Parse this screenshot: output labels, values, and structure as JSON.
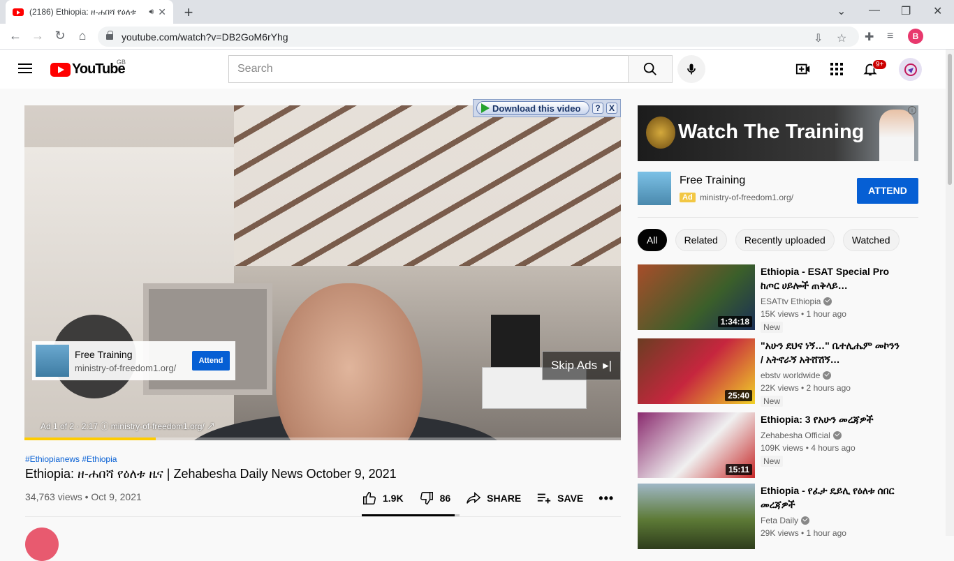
{
  "browser": {
    "tab_title": "(2186) Ethiopia: ዘ-ሐበሻ የዕለቱ",
    "url": "youtube.com/watch?v=DB2GoM6rYhg",
    "profile_initial": "B"
  },
  "header": {
    "logo_text": "YouTube",
    "country_code": "GB",
    "search_placeholder": "Search",
    "notification_count": "9+"
  },
  "player": {
    "download_label": "Download this video",
    "help_label": "?",
    "close_label": "X",
    "overlay_ad": {
      "title": "Free Training",
      "url": "ministry-of-freedom1.org/",
      "cta": "Attend"
    },
    "skip_label": "Skip Ads",
    "ad_meta": "Ad 1 of 2 · 2:17",
    "ad_meta_url": "ministry-of-freedom1.org/",
    "progress_fraction": 0.22
  },
  "video": {
    "hashtags": "#Ethiopianews #Ethiopia",
    "title": "Ethiopia: ዘ-ሐበሻ የዕለቱ ዜና | Zehabesha Daily News October 9, 2021",
    "meta": "34,763 views • Oct 9, 2021",
    "likes": "1.9K",
    "dislikes": "86",
    "share_label": "SHARE",
    "save_label": "SAVE",
    "like_fraction": 0.95
  },
  "sidebar": {
    "banner_text": "Watch The Training",
    "promo": {
      "title": "Free Training",
      "ad_badge": "Ad",
      "url": "ministry-of-freedom1.org/",
      "cta": "ATTEND"
    },
    "chips": [
      "All",
      "Related",
      "Recently uploaded",
      "Watched"
    ],
    "recommendations": [
      {
        "title": "Ethiopia - ESAT Special Pro ከጦር ሀይሎች ጠቅላይ…",
        "channel": "ESATtv Ethiopia",
        "views": "15K views • 1 hour ago",
        "badge": "New",
        "duration": "1:34:18",
        "color": "#a84d2a"
      },
      {
        "title": "\"አሁን ደህና ነኝ…\" ቤተሊሔም መኮንን / አትኖራኝ አትሸሽኝ…",
        "channel": "ebstv worldwide",
        "views": "22K views • 2 hours ago",
        "badge": "New",
        "duration": "25:40",
        "color": "#c6263e"
      },
      {
        "title": "Ethiopia: 3 የአሁን መረጃዎች",
        "channel": "Zehabesha Official",
        "views": "109K views • 4 hours ago",
        "badge": "New",
        "duration": "15:11",
        "color": "#8a2a6e"
      },
      {
        "title": "Ethiopia - የፈታ ዴይሊ የዕለቱ ሰበር መረጃዎች",
        "channel": "Feta Daily",
        "views": "29K views • 1 hour ago",
        "badge": "",
        "duration": "",
        "color": "#5d7a36"
      }
    ]
  }
}
